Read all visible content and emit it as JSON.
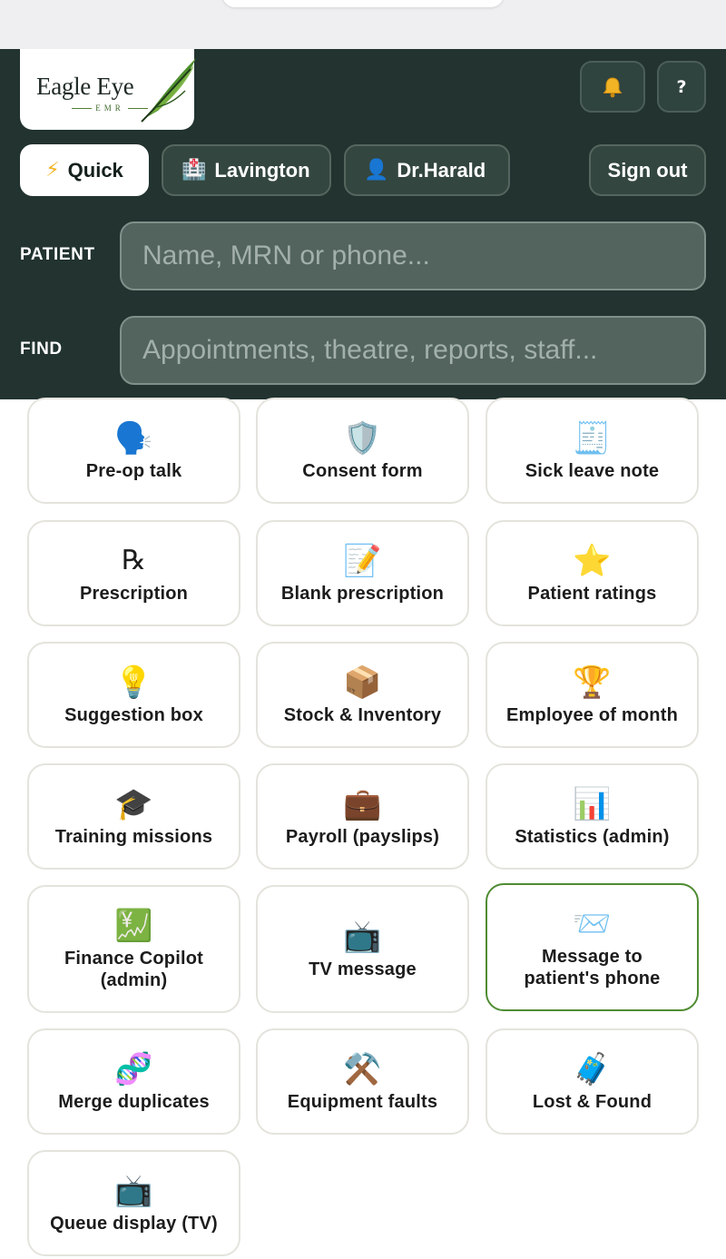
{
  "app": {
    "logo_text": "Eagle Eye",
    "logo_sub": "EMR"
  },
  "header": {
    "bell_icon": "bell-icon",
    "help_label": "?",
    "quick": {
      "icon": "⚡",
      "label": "Quick"
    },
    "location": {
      "icon": "🏥",
      "label": "Lavington"
    },
    "doctor": {
      "icon": "👤",
      "label": "Dr.Harald"
    },
    "signout_label": "Sign out"
  },
  "search": {
    "patient_label": "PATIENT",
    "patient_placeholder": "Name, MRN or phone...",
    "find_label": "FIND",
    "find_placeholder": "Appointments, theatre, reports, staff..."
  },
  "tiles": [
    {
      "icon": "🗣️",
      "label": "Pre-op talk"
    },
    {
      "icon": "🛡️",
      "label": "Consent form"
    },
    {
      "icon": "🧾",
      "label": "Sick leave note"
    },
    {
      "icon": "℞",
      "label": "Prescription"
    },
    {
      "icon": "📝",
      "label": "Blank prescription"
    },
    {
      "icon": "⭐",
      "label": "Patient ratings"
    },
    {
      "icon": "💡",
      "label": "Suggestion box"
    },
    {
      "icon": "📦",
      "label": "Stock & Inventory"
    },
    {
      "icon": "🏆",
      "label": "Employee of month"
    },
    {
      "icon": "🎓",
      "label": "Training missions"
    },
    {
      "icon": "💼",
      "label": "Payroll (payslips)"
    },
    {
      "icon": "📊",
      "label": "Statistics (admin)"
    },
    {
      "icon": "💹",
      "label": "Finance Copilot (admin)"
    },
    {
      "icon": "📺",
      "label": "TV message"
    },
    {
      "icon": "📨",
      "label": "Message to patient's phone"
    },
    {
      "icon": "🧬",
      "label": "Merge duplicates"
    },
    {
      "icon": "⚒️",
      "label": "Equipment faults"
    },
    {
      "icon": "🧳",
      "label": "Lost & Found"
    },
    {
      "icon": "📺",
      "label": "Queue display (TV)"
    }
  ],
  "colors": {
    "header_bg": "#223330",
    "accent_green": "#4f8c32"
  }
}
